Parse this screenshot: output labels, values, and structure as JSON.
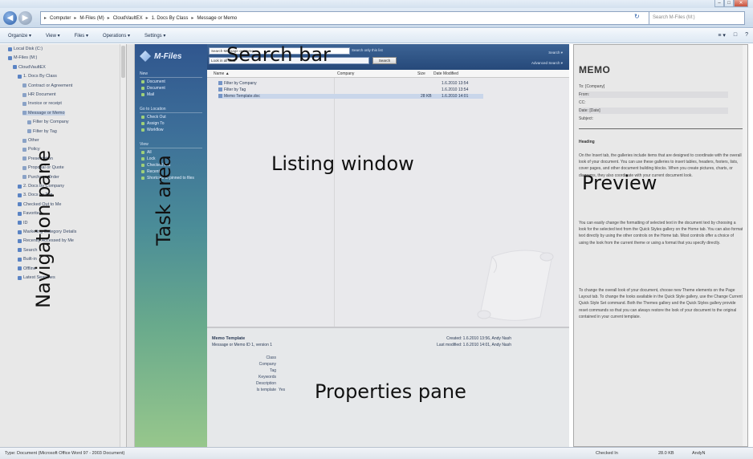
{
  "window": {
    "minimize": "–",
    "maximize": "□",
    "close": "✕"
  },
  "address": {
    "back_icon": "arrow-left-icon",
    "forward_icon": "arrow-right-icon",
    "recent": "▾",
    "crumbs": [
      "Computer",
      "M-Files (M)",
      "CloudVaultEX",
      "1. Docs By Class",
      "Message or Memo"
    ],
    "refresh": "↻",
    "search_placeholder": "Search M-Files (M:)"
  },
  "toolbar": {
    "items": [
      "Organize ▾",
      "View ▾",
      "Files ▾",
      "Operations ▾",
      "Settings ▾"
    ],
    "right": [
      "≡ ▾",
      "□",
      "?"
    ]
  },
  "navigation": {
    "items": [
      {
        "label": "Local Disk (C:)",
        "indent": 1
      },
      {
        "label": "M-Files (M:)",
        "indent": 1
      },
      {
        "label": "CloudVaultEX",
        "indent": 2
      },
      {
        "label": "1. Docs By Class",
        "indent": 3
      },
      {
        "label": "Contract or Agreement",
        "indent": 4
      },
      {
        "label": "HR Document",
        "indent": 4
      },
      {
        "label": "Invoice or receipt",
        "indent": 4
      },
      {
        "label": "Message or Memo",
        "indent": 4,
        "selected": true
      },
      {
        "label": "Filter by Company",
        "indent": 5
      },
      {
        "label": "Filter by Tag",
        "indent": 5
      },
      {
        "label": "Other",
        "indent": 4
      },
      {
        "label": "Policy",
        "indent": 4
      },
      {
        "label": "Presentation",
        "indent": 4
      },
      {
        "label": "Proposal or Quote",
        "indent": 4
      },
      {
        "label": "Purchase Order",
        "indent": 4
      },
      {
        "label": "2. Docs by Company",
        "indent": 3
      },
      {
        "label": "3. Docs by Tag",
        "indent": 3
      },
      {
        "label": "Checked Out to Me",
        "indent": 3
      },
      {
        "label": "Favorites",
        "indent": 3
      },
      {
        "label": "ID",
        "indent": 3
      },
      {
        "label": "Marketing Category Details",
        "indent": 3
      },
      {
        "label": "Recently Accessed by Me",
        "indent": 3
      },
      {
        "label": "Search",
        "indent": 3
      },
      {
        "label": "Built-in",
        "indent": 3
      },
      {
        "label": "Offline",
        "indent": 3
      },
      {
        "label": "Latest Searches",
        "indent": 3
      }
    ]
  },
  "task_area": {
    "logo_text": "M-Files",
    "sections": [
      {
        "heading": "New",
        "items": [
          "Document",
          "Document",
          "Mail"
        ]
      },
      {
        "heading": "Go to Location",
        "items": [
          "Check Out",
          "Assign To",
          "Workflow"
        ]
      },
      {
        "heading": "View",
        "items": [
          "All",
          "Lock",
          "Checked Out",
          "Recent",
          "Shortcuts to pinned to files"
        ]
      }
    ]
  },
  "listing": {
    "search_input": "Search Message or Memo",
    "search_only_option": "Search only this list",
    "search_select": "Look in all data",
    "search_button": "Search",
    "quick_links": [
      "Search ▾",
      "Advanced Search ▾"
    ],
    "columns": {
      "name": "Name ▲",
      "company": "Company",
      "size": "Size",
      "date": "Date Modified"
    },
    "rows": [
      {
        "name": "Filter by Company",
        "size": "",
        "date": "1.6.2010 13:54",
        "selected": false
      },
      {
        "name": "Filter by Tag",
        "size": "",
        "date": "1.6.2010 13:54",
        "selected": false
      },
      {
        "name": "Memo Template.doc",
        "size": "28 KB",
        "date": "1.6.2010 14:01",
        "selected": true
      }
    ]
  },
  "properties": {
    "title": "Memo Template",
    "class_line": "Message or Memo   ID 1, version 1",
    "created": "Created: 1.6.2010 13:56, Andy Nash",
    "modified": "Last modified: 1.6.2010 14:01, Andy Nash",
    "fields": [
      {
        "label": "Class",
        "value": ""
      },
      {
        "label": "Company",
        "value": ""
      },
      {
        "label": "Tag",
        "value": ""
      },
      {
        "label": "Keywords",
        "value": ""
      },
      {
        "label": "Description",
        "value": ""
      },
      {
        "label": "Is template",
        "value": "Yes"
      }
    ]
  },
  "preview": {
    "memo_title": "MEMO",
    "fields": [
      {
        "text": "To: [Company]",
        "shade": false
      },
      {
        "text": "From:",
        "shade": true
      },
      {
        "text": "CC:",
        "shade": false
      },
      {
        "text": "Date: [Date]",
        "shade": true
      },
      {
        "text": "Subject:",
        "shade": false
      }
    ],
    "heading": "Heading",
    "para1": "On the Insert tab, the galleries include items that are designed to coordinate with the overall look of your document. You can use these galleries to insert tables, headers, footers, lists, cover pages, and other document building blocks. When you create pictures, charts, or diagrams, they also coordinate with your current document look.",
    "para2": "You can easily change the formatting of selected text in the document text by choosing a look for the selected text from the Quick Styles gallery on the Home tab. You can also format text directly by using the other controls on the Home tab. Most controls offer a choice of using the look from the current theme or using a format that you specify directly.",
    "para3": "To change the overall look of your document, choose new Theme elements on the Page Layout tab. To change the looks available in the Quick Style gallery, use the Change Current Quick Style Set command. Both the Themes gallery and the Quick Styles gallery provide reset commands so that you can always restore the look of your document to the original contained in your current template."
  },
  "status": {
    "left": "Type: Document (Microsoft Office Word 97 - 2003 Document)",
    "checked": "Checked In",
    "size": "28.0 KB",
    "user": "AndyN"
  },
  "callouts": {
    "search_bar": "Search bar",
    "listing_window": "Listing window",
    "preview": "Preview",
    "properties_pane": "Properties pane",
    "navigation_pane": "Navigation pane",
    "task_area": "Task area"
  }
}
